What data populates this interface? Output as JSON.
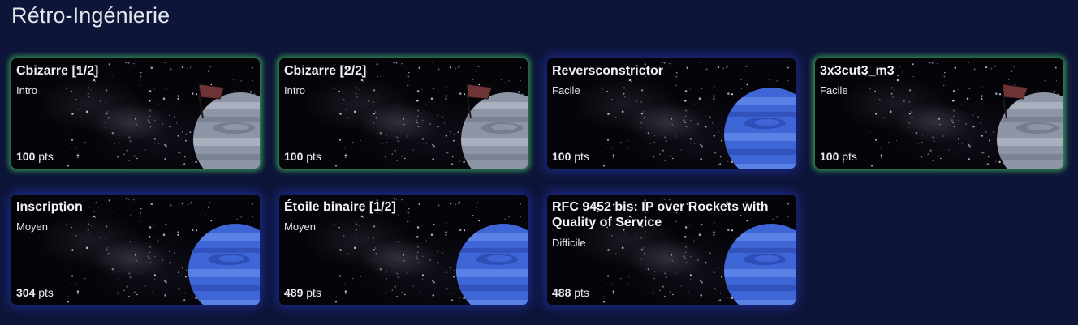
{
  "section": {
    "title": "Rétro-Ingénierie"
  },
  "points_unit": "pts",
  "challenges": [
    {
      "title": "Cbizarre [1/2]",
      "difficulty": "Intro",
      "points": "100",
      "solved": true,
      "planet": "grey-flag"
    },
    {
      "title": "Cbizarre [2/2]",
      "difficulty": "Intro",
      "points": "100",
      "solved": true,
      "planet": "grey-flag"
    },
    {
      "title": "Reversconstrictor",
      "difficulty": "Facile",
      "points": "100",
      "solved": false,
      "planet": "blue"
    },
    {
      "title": "3x3cut3_m3",
      "difficulty": "Facile",
      "points": "100",
      "solved": true,
      "planet": "grey-flag"
    },
    {
      "title": "Inscription",
      "difficulty": "Moyen",
      "points": "304",
      "solved": false,
      "planet": "blue"
    },
    {
      "title": "Étoile binaire [1/2]",
      "difficulty": "Moyen",
      "points": "489",
      "solved": false,
      "planet": "blue"
    },
    {
      "title": "RFC 9452 bis: IP over Rockets with Quality of Service",
      "difficulty": "Difficile",
      "points": "488",
      "solved": false,
      "planet": "blue"
    }
  ],
  "colors": {
    "background": "#0d1538",
    "solved_glow": "#41be5f",
    "unsolved_glow": "#2d3cd2",
    "planet_grey": "#8e95a6",
    "planet_blue": "#3f66d6",
    "flag": "#6e3435"
  }
}
